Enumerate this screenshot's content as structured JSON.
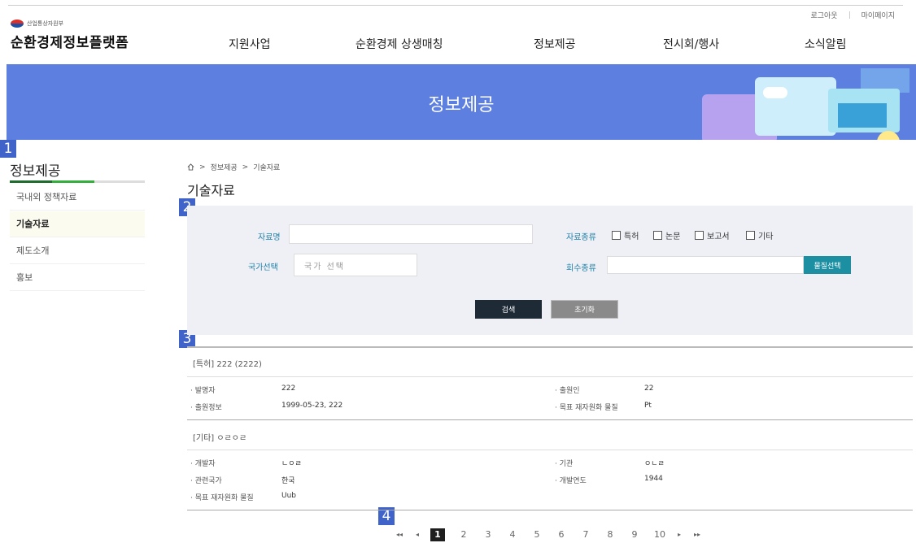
{
  "util_links": [
    "로그아웃",
    "마이페이지"
  ],
  "logo": {
    "ministry": "산업통상자원부",
    "site_title": "순환경제정보플랫폼"
  },
  "gnb": [
    "지원사업",
    "순환경제 상생매칭",
    "정보제공",
    "전시회/행사",
    "소식알림"
  ],
  "banner": {
    "title": "정보제공"
  },
  "markers": [
    "1",
    "2",
    "3",
    "4"
  ],
  "lnb": {
    "title": "정보제공",
    "items": [
      "국내외 정책자료",
      "기술자료",
      "제도소개",
      "홍보"
    ],
    "active_index": 1
  },
  "breadcrumb": [
    "정보제공",
    "기술자료"
  ],
  "page_title": "기술자료",
  "search": {
    "name_label": "자료명",
    "name_value": "",
    "country_label": "국가선택",
    "country_placeholder": "국가 선택",
    "type_label": "자료종류",
    "types": [
      "특허",
      "논문",
      "보고서",
      "기타"
    ],
    "recovery_label": "회수종류",
    "recovery_value": "",
    "material_button": "물질선택",
    "search_button": "검색",
    "reset_button": "초기화"
  },
  "results": [
    {
      "title": "[특허] 222 (2222)",
      "fields": [
        {
          "label": "· 발명자",
          "value": "222"
        },
        {
          "label": "· 출원인",
          "value": "22"
        },
        {
          "label": "· 출원정보",
          "value": "1999-05-23, 222"
        },
        {
          "label": "· 목표 재자원화 물질",
          "value": "Pt"
        }
      ]
    },
    {
      "title": "[기타] ㅇㄹㅇㄹ",
      "fields": [
        {
          "label": "· 개발자",
          "value": "ㄴㅇㄹ"
        },
        {
          "label": "· 기관",
          "value": "ㅇㄴㄹ"
        },
        {
          "label": "· 관련국가",
          "value": "한국"
        },
        {
          "label": "· 개발연도",
          "value": "1944"
        },
        {
          "label": "· 목표 재자원화 물질",
          "value": "Uub"
        }
      ]
    }
  ],
  "pagination": {
    "first": "◂◂",
    "prev": "◂",
    "pages": [
      "1",
      "2",
      "3",
      "4",
      "5",
      "6",
      "7",
      "8",
      "9",
      "10"
    ],
    "current": "1",
    "next": "▸",
    "last": "▸▸"
  },
  "colors": {
    "banner": "#5c7fe0",
    "marker": "#3f63c9",
    "label": "#1f7fa7",
    "search_button": "#1e2a36",
    "reset_button": "#8a8a8a",
    "material_button": "#1c8fa3"
  }
}
